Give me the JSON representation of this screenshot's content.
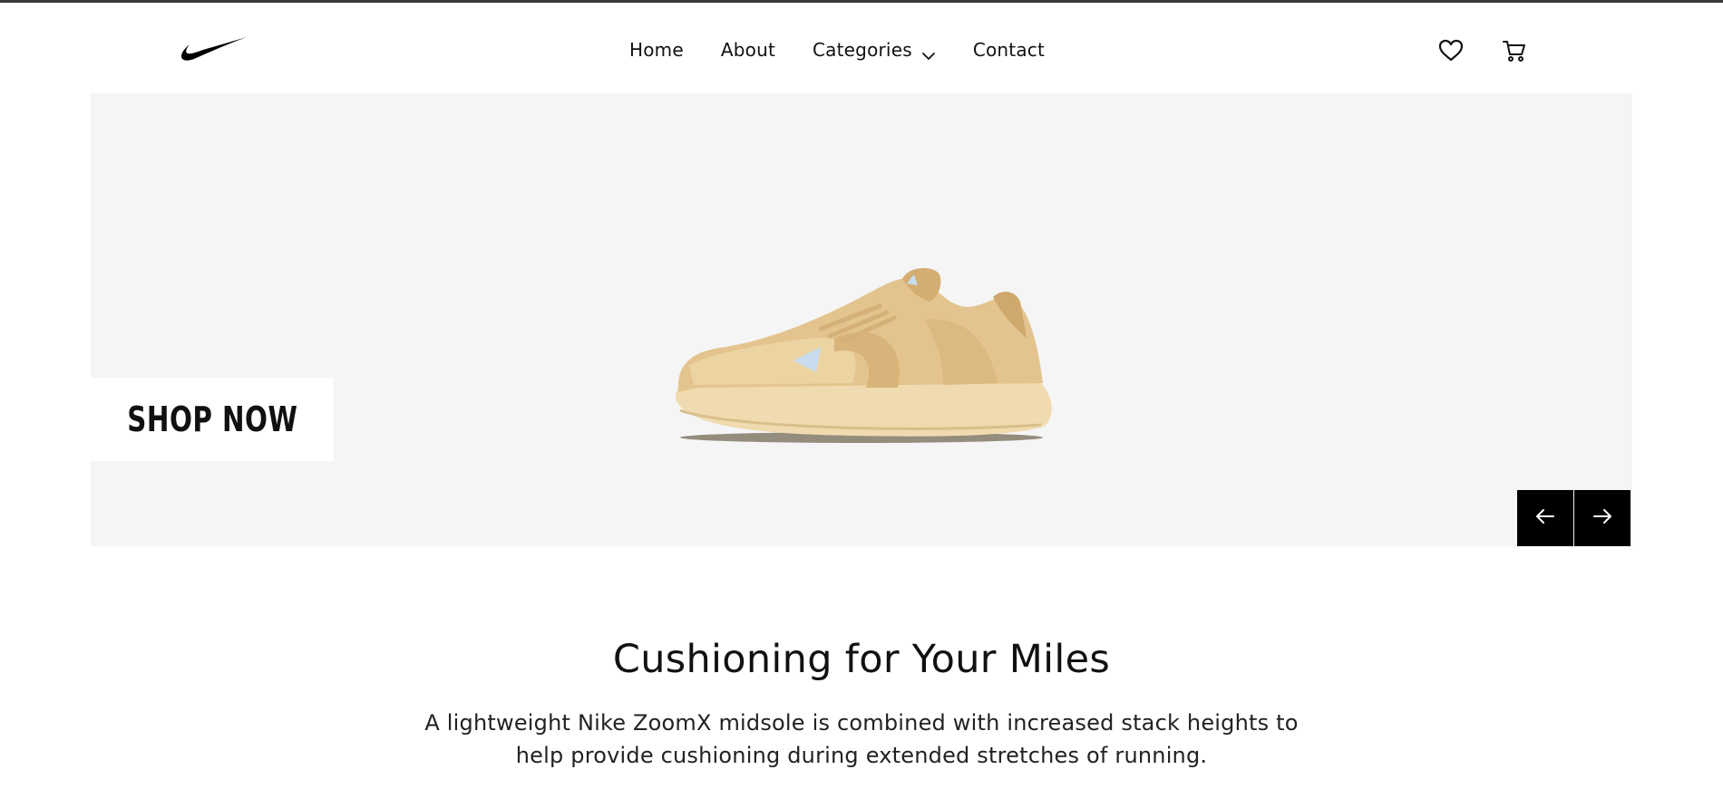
{
  "header": {
    "logo_icon": "nike-swoosh-icon",
    "nav": [
      {
        "label": "Home"
      },
      {
        "label": "About"
      },
      {
        "label": "Categories",
        "icon": "chevron-down-icon"
      },
      {
        "label": "Contact"
      }
    ],
    "wishlist_icon": "heart-icon",
    "cart_icon": "shopping-cart-icon"
  },
  "hero": {
    "cta_label": "SHOP NOW",
    "product_image": "beige-running-shoe",
    "prev_icon": "arrow-left-icon",
    "next_icon": "arrow-right-icon",
    "background_color": "#f5f5f5"
  },
  "feature": {
    "title": "Cushioning for Your Miles",
    "description": "A lightweight Nike ZoomX midsole is combined with increased stack heights to help provide cushioning during extended stretches of running."
  },
  "colors": {
    "accent": "#000000",
    "text": "#111111",
    "shoe": "#e8cfa0"
  }
}
